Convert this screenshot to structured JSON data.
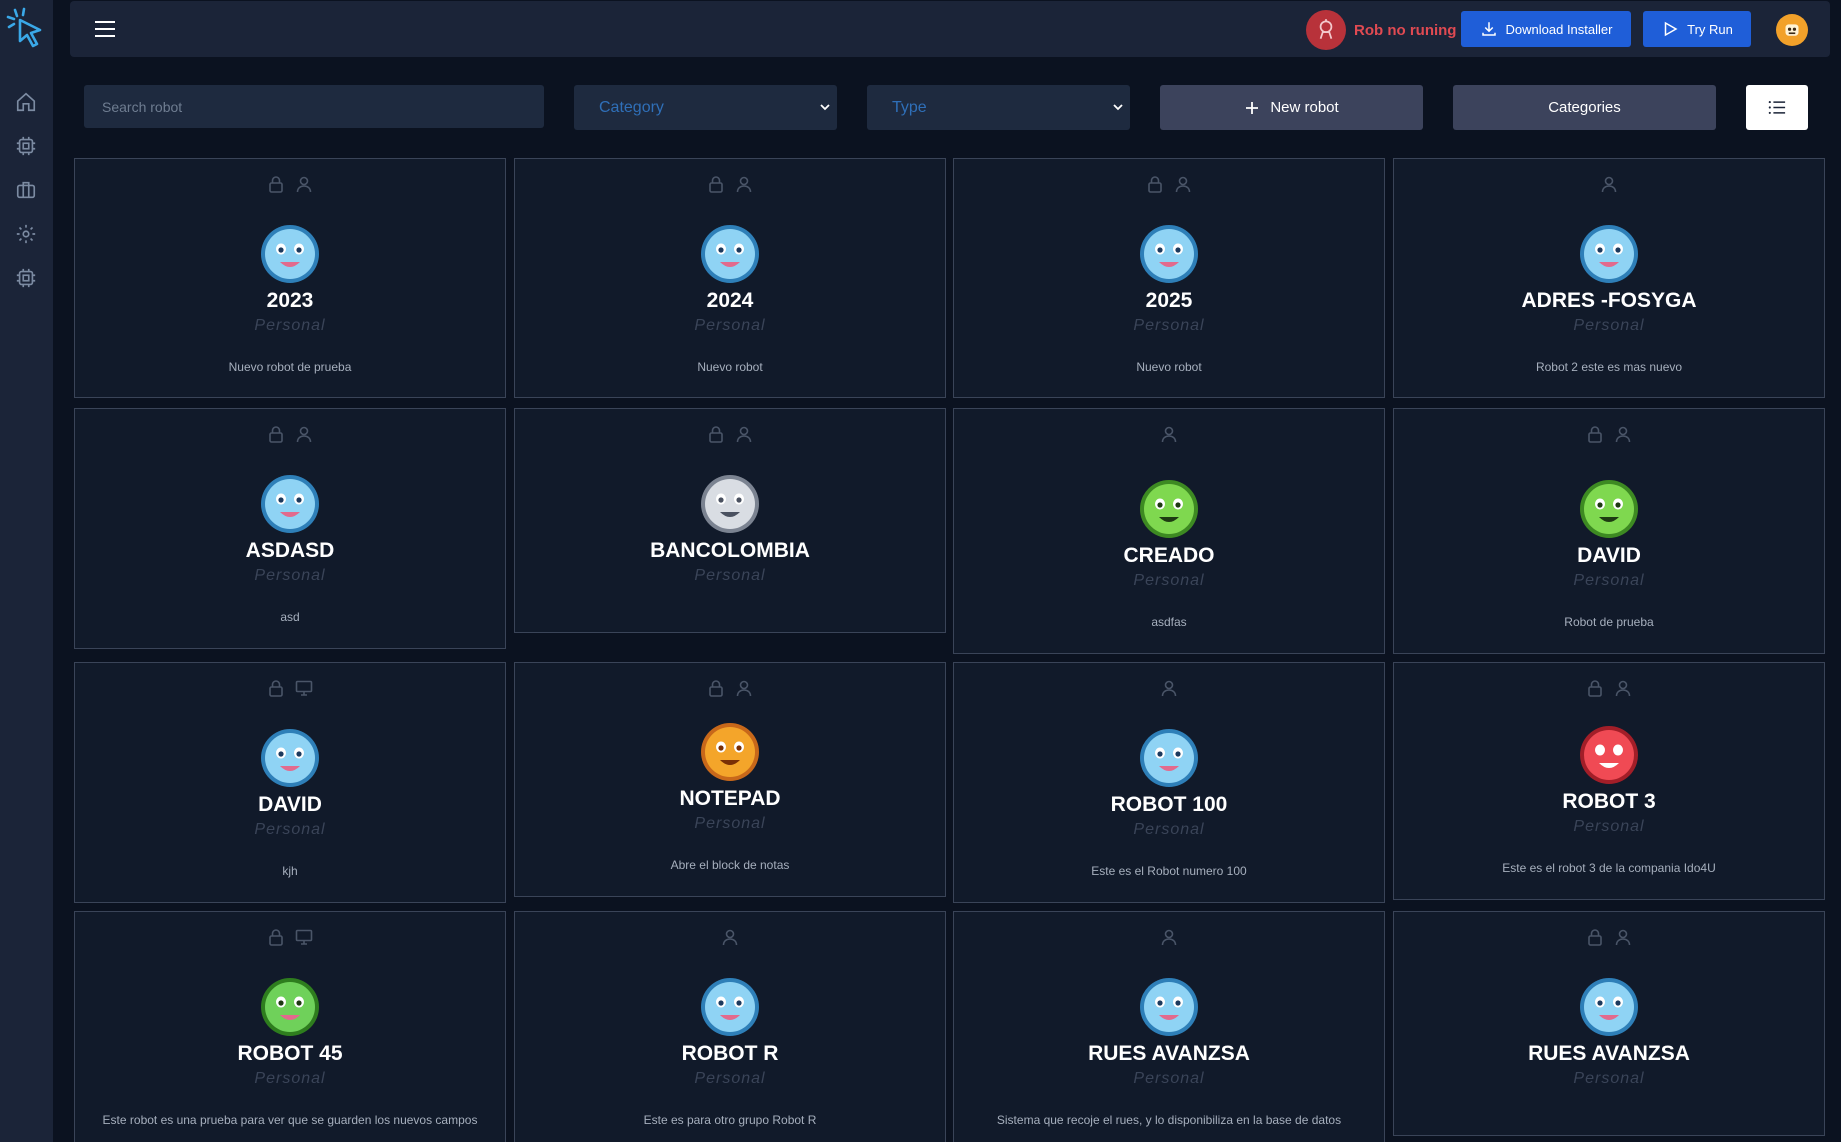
{
  "topbar": {
    "status_text": "Rob no runing",
    "download_label": "Download Installer",
    "try_label": "Try Run"
  },
  "filters": {
    "search_placeholder": "Search robot",
    "category_label": "Category",
    "type_label": "Type",
    "new_robot_label": "New robot",
    "categories_label": "Categories"
  },
  "colors": {
    "accent": "#1f5ed8",
    "status_red": "#e04a52",
    "card_border": "#3a4458"
  },
  "robots": [
    {
      "name": "2023",
      "type": "Personal",
      "desc": "Nuevo robot de prueba",
      "icons": [
        "lock-icon",
        "user-icon"
      ],
      "avatar": "blue"
    },
    {
      "name": "2024",
      "type": "Personal",
      "desc": "Nuevo robot",
      "icons": [
        "lock-icon",
        "user-icon"
      ],
      "avatar": "blue"
    },
    {
      "name": "2025",
      "type": "Personal",
      "desc": "Nuevo robot",
      "icons": [
        "lock-icon",
        "user-icon"
      ],
      "avatar": "blue"
    },
    {
      "name": "ADRES -FOSYGA",
      "type": "Personal",
      "desc": "Robot 2 este es mas nuevo",
      "icons": [
        "user-icon"
      ],
      "avatar": "blue"
    },
    {
      "name": "ASDASD",
      "type": "Personal",
      "desc": "asd",
      "icons": [
        "lock-icon",
        "user-icon"
      ],
      "avatar": "blue"
    },
    {
      "name": "BANCOLOMBIA",
      "type": "Personal",
      "desc": "",
      "icons": [
        "lock-icon",
        "user-icon"
      ],
      "avatar": "gray"
    },
    {
      "name": "CREADO",
      "type": "Personal",
      "desc": "asdfas",
      "icons": [
        "user-icon"
      ],
      "avatar": "green"
    },
    {
      "name": "DAVID",
      "type": "Personal",
      "desc": "Robot de prueba",
      "icons": [
        "lock-icon",
        "user-icon"
      ],
      "avatar": "green"
    },
    {
      "name": "DAVID",
      "type": "Personal",
      "desc": "kjh",
      "icons": [
        "lock-icon",
        "monitor-icon"
      ],
      "avatar": "blue"
    },
    {
      "name": "NOTEPAD",
      "type": "Personal",
      "desc": "Abre el block de notas",
      "icons": [
        "lock-icon",
        "user-icon"
      ],
      "avatar": "orange"
    },
    {
      "name": "ROBOT 100",
      "type": "Personal",
      "desc": "Este es el Robot numero 100",
      "icons": [
        "user-icon"
      ],
      "avatar": "blue"
    },
    {
      "name": "ROBOT 3",
      "type": "Personal",
      "desc": "Este es el robot 3 de la compania Ido4U",
      "icons": [
        "lock-icon",
        "user-icon"
      ],
      "avatar": "red"
    },
    {
      "name": "ROBOT 45",
      "type": "Personal",
      "desc": "Este robot es una prueba para ver que se guarden los nuevos campos",
      "icons": [
        "lock-icon",
        "monitor-icon"
      ],
      "avatar": "lime"
    },
    {
      "name": "ROBOT R",
      "type": "Personal",
      "desc": "Este es para otro grupo Robot R",
      "icons": [
        "user-icon"
      ],
      "avatar": "blue"
    },
    {
      "name": "RUES AVANZSA",
      "type": "Personal",
      "desc": "Sistema que recoje el rues, y lo disponibiliza en la base de datos",
      "icons": [
        "user-icon"
      ],
      "avatar": "blue"
    },
    {
      "name": "RUES AVANZSA",
      "type": "Personal",
      "desc": "",
      "icons": [
        "lock-icon",
        "user-icon"
      ],
      "avatar": "blue"
    }
  ]
}
